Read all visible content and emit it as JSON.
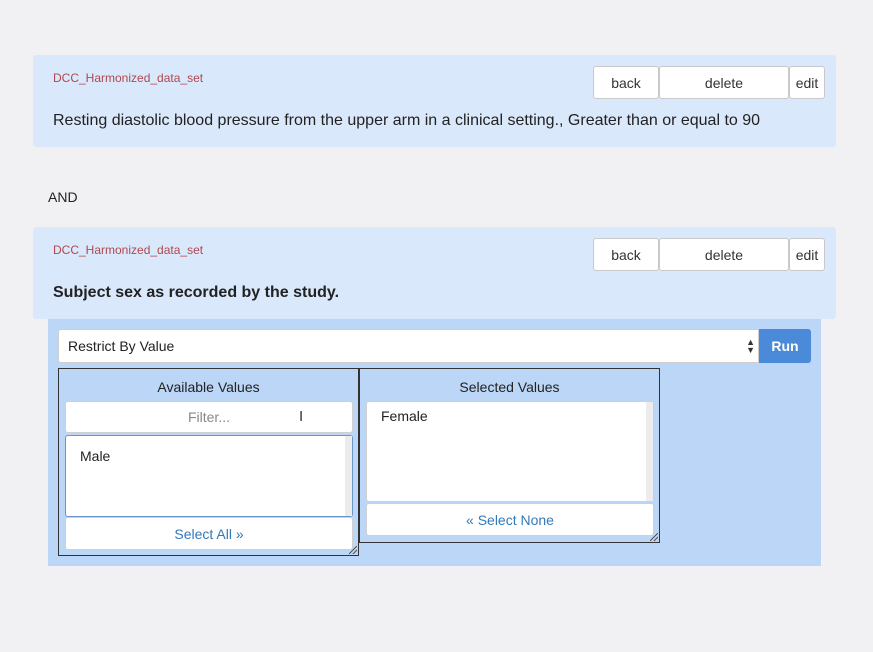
{
  "cards": [
    {
      "dataset": "DCC_Harmonized_data_set",
      "description": "Resting diastolic blood pressure from the upper arm in a clinical setting., Greater than or equal to 90",
      "back_label": "back",
      "delete_label": "delete",
      "edit_label": "edit"
    },
    {
      "dataset": "DCC_Harmonized_data_set",
      "description": "Subject sex as recorded by the study.",
      "back_label": "back",
      "delete_label": "delete",
      "edit_label": "edit"
    }
  ],
  "operator": "AND",
  "filter": {
    "mode_selected": "Restrict By Value",
    "run_label": "Run",
    "available": {
      "title": "Available Values",
      "filter_placeholder": "Filter...",
      "items": [
        "Male"
      ],
      "select_all_label": "Select All »"
    },
    "selected": {
      "title": "Selected Values",
      "items": [
        "Female"
      ],
      "select_none_label": "« Select None"
    }
  },
  "colors": {
    "background": "#f1f1f3",
    "card": "#dae8fb",
    "panel": "#bbd6f6",
    "run_button": "#4a8ad8",
    "dataset_text": "#b0484f",
    "link": "#337ab7"
  }
}
